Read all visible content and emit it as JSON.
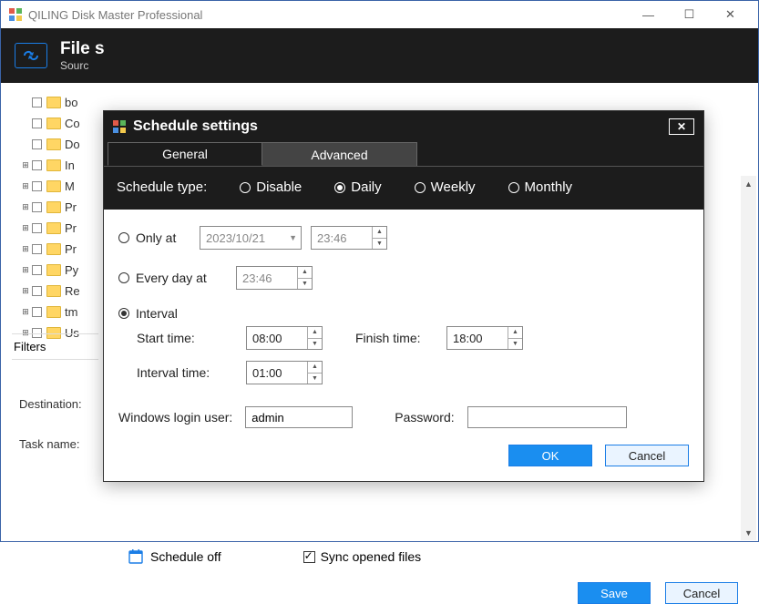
{
  "app": {
    "title": "QILING Disk Master Professional"
  },
  "header": {
    "title_prefix": "File s",
    "subtitle_prefix": "Sourc"
  },
  "tree": {
    "items": [
      {
        "label": "bo",
        "expandable": false
      },
      {
        "label": "Co",
        "expandable": false
      },
      {
        "label": "Do",
        "expandable": false
      },
      {
        "label": "In",
        "expandable": true
      },
      {
        "label": "M",
        "expandable": true
      },
      {
        "label": "Pr",
        "expandable": true
      },
      {
        "label": "Pr",
        "expandable": true
      },
      {
        "label": "Pr",
        "expandable": true
      },
      {
        "label": "Py",
        "expandable": true
      },
      {
        "label": "Re",
        "expandable": true
      },
      {
        "label": "tm",
        "expandable": true
      },
      {
        "label": "Us",
        "expandable": true
      }
    ]
  },
  "filters_label": "Filters",
  "form": {
    "destination_label": "Destination:",
    "taskname_label": "Task name:"
  },
  "bottom": {
    "schedule_off": "Schedule off",
    "sync_opened": "Sync opened files"
  },
  "main_buttons": {
    "save": "Save",
    "cancel": "Cancel"
  },
  "modal": {
    "title": "Schedule settings",
    "tabs": {
      "general": "General",
      "advanced": "Advanced"
    },
    "schedule_type_label": "Schedule type:",
    "types": {
      "disable": "Disable",
      "daily": "Daily",
      "weekly": "Weekly",
      "monthly": "Monthly"
    },
    "selected_type": "daily",
    "options": {
      "only_at_label": "Only at",
      "only_at_date": "2023/10/21",
      "only_at_time": "23:46",
      "every_day_label": "Every day at",
      "every_day_time": "23:46",
      "interval_label": "Interval",
      "start_label": "Start time:",
      "start_value": "08:00",
      "finish_label": "Finish time:",
      "finish_value": "18:00",
      "interval_time_label": "Interval time:",
      "interval_time_value": "01:00",
      "selected_option": "interval"
    },
    "login": {
      "user_label": "Windows login user:",
      "user_value": "admin",
      "password_label": "Password:",
      "password_value": ""
    },
    "buttons": {
      "ok": "OK",
      "cancel": "Cancel"
    }
  }
}
